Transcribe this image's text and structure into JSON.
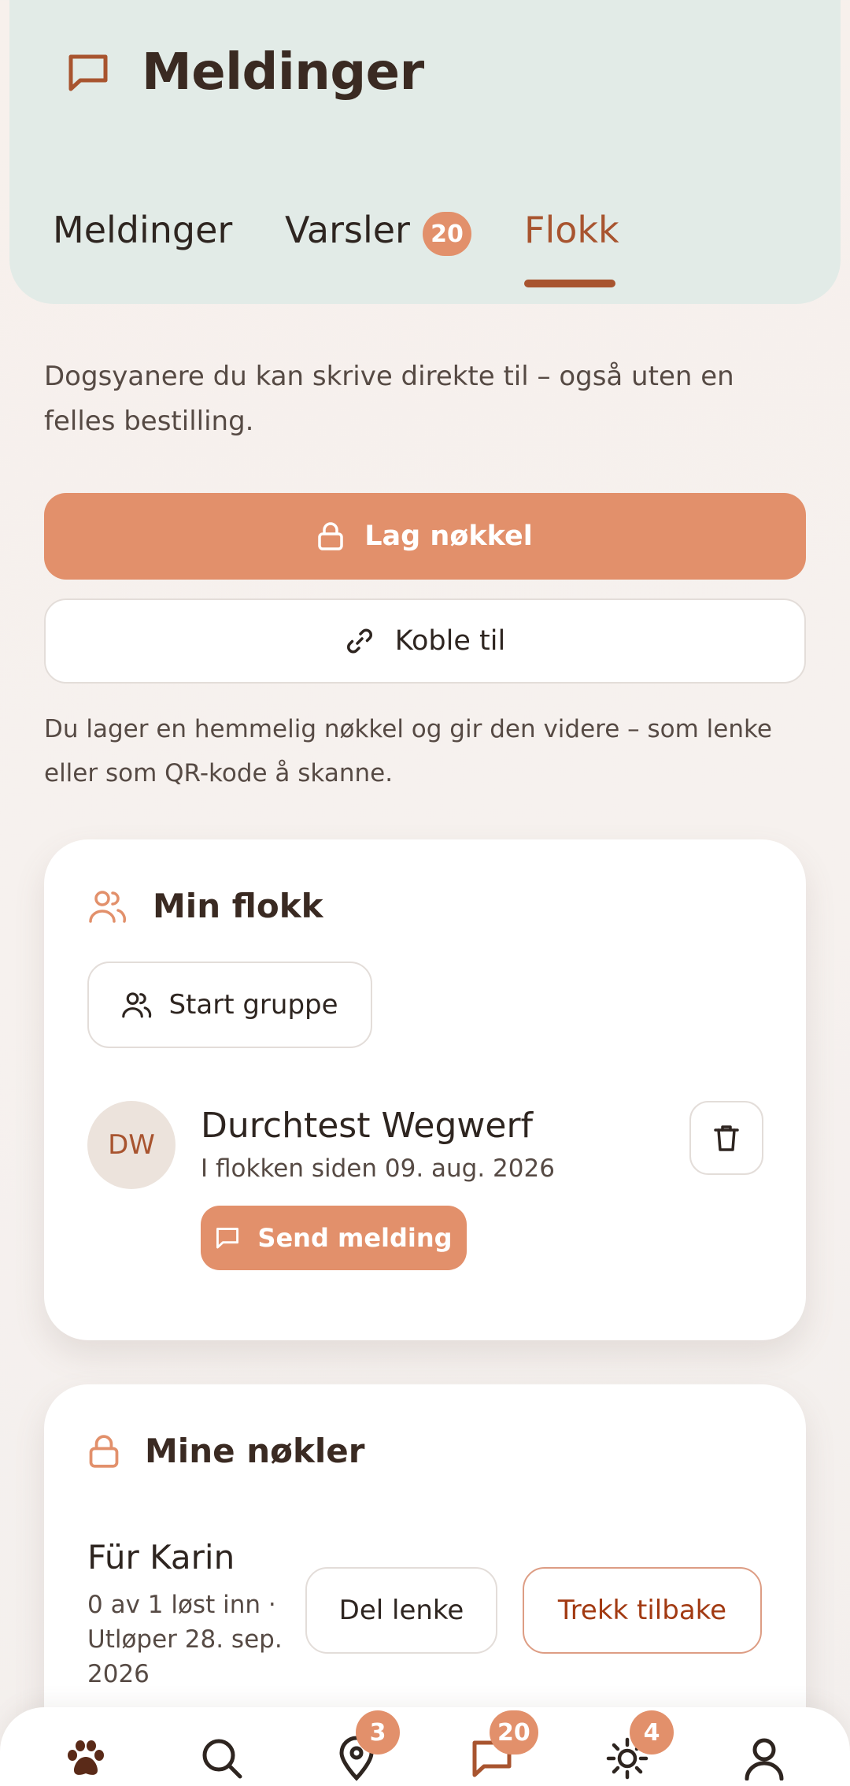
{
  "header": {
    "title": "Meldinger",
    "tabs": [
      {
        "label": "Meldinger",
        "active": false
      },
      {
        "label": "Varsler",
        "badge": "20",
        "active": false
      },
      {
        "label": "Flokk",
        "active": true
      }
    ]
  },
  "intro_text": "Dogsyanere du kan skrive direkte til – også uten en felles bestilling.",
  "buttons": {
    "create_key": "Lag nøkkel",
    "connect": "Koble til"
  },
  "note_text": "Du lager en hemmelig nøkkel og gir den videre – som lenke eller som QR-kode å skanne.",
  "my_pack": {
    "title": "Min flokk",
    "start_group": "Start gruppe",
    "members": [
      {
        "initials": "DW",
        "name": "Durchtest Wegwerf",
        "since": "I flokken siden 09. aug. 2026",
        "send_label": "Send melding"
      }
    ]
  },
  "my_keys": {
    "title": "Mine nøkler",
    "keys": [
      {
        "name": "Für Karin",
        "status": "0 av 1 løst inn · Utløper 28. sep. 2026",
        "share_label": "Del lenke",
        "revoke_label": "Trekk tilbake"
      }
    ]
  },
  "bottom_nav": [
    {
      "icon": "paw-icon",
      "active": true
    },
    {
      "icon": "search-icon"
    },
    {
      "icon": "location-pin-icon",
      "badge": "3"
    },
    {
      "icon": "message-icon",
      "badge": "20"
    },
    {
      "icon": "sun-icon",
      "badge": "4"
    },
    {
      "icon": "user-icon"
    }
  ],
  "colors": {
    "accent": "#e2906b",
    "accent_dark": "#a8542f",
    "header_bg": "#e2ebe7",
    "danger_text": "#a23a12"
  }
}
